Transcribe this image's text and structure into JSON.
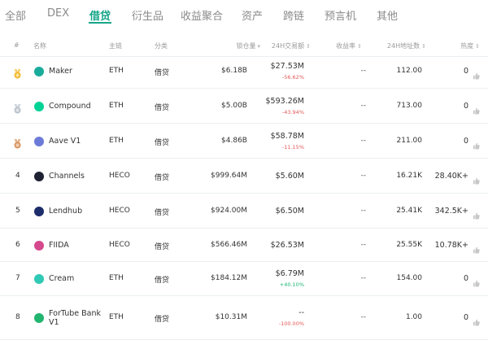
{
  "tabs": [
    {
      "label": "全部",
      "active": false
    },
    {
      "label": "DEX",
      "active": false
    },
    {
      "label": "借贷",
      "active": true
    },
    {
      "label": "衍生品",
      "active": false
    },
    {
      "label": "收益聚合",
      "active": false
    },
    {
      "label": "资产",
      "active": false
    },
    {
      "label": "跨链",
      "active": false
    },
    {
      "label": "预言机",
      "active": false
    },
    {
      "label": "其他",
      "active": false
    }
  ],
  "table": {
    "headers": {
      "rank": "#",
      "name": "名称",
      "chain": "主链",
      "category": "分类",
      "tvl": "锁仓量",
      "volume": "24H交易额",
      "yield": "收益率",
      "addresses": "24H地址数",
      "heat": "热度"
    },
    "rows": [
      {
        "rank": "",
        "medal": "gold",
        "name": "Maker",
        "name_line2": "",
        "icon_color": "#1aab9b",
        "chain": "ETH",
        "category": "借贷",
        "tvl": "$6.18B",
        "volume": "$27.53M",
        "change": "-56.62%",
        "change_dir": "neg",
        "yield": "--",
        "addresses": "112.00",
        "heat": "0"
      },
      {
        "rank": "",
        "medal": "silver",
        "name": "Compound",
        "name_line2": "",
        "icon_color": "#00d395",
        "chain": "ETH",
        "category": "借贷",
        "tvl": "$5.00B",
        "volume": "$593.26M",
        "change": "-43.94%",
        "change_dir": "neg",
        "yield": "--",
        "addresses": "713.00",
        "heat": "0"
      },
      {
        "rank": "",
        "medal": "bronze",
        "name": "Aave V1",
        "name_line2": "",
        "icon_color": "#6c7bd8",
        "chain": "ETH",
        "category": "借贷",
        "tvl": "$4.86B",
        "volume": "$58.78M",
        "change": "-11.15%",
        "change_dir": "neg",
        "yield": "--",
        "addresses": "211.00",
        "heat": "0"
      },
      {
        "rank": "4",
        "medal": "",
        "name": "Channels",
        "name_line2": "",
        "icon_color": "#1f2233",
        "chain": "HECO",
        "category": "借贷",
        "tvl": "$999.64M",
        "volume": "$5.60M",
        "change": "",
        "change_dir": "",
        "yield": "--",
        "addresses": "16.21K",
        "heat": "28.40K+"
      },
      {
        "rank": "5",
        "medal": "",
        "name": "Lendhub",
        "name_line2": "",
        "icon_color": "#1d2c6b",
        "chain": "HECO",
        "category": "借贷",
        "tvl": "$924.00M",
        "volume": "$6.50M",
        "change": "",
        "change_dir": "",
        "yield": "--",
        "addresses": "25.41K",
        "heat": "342.5K+"
      },
      {
        "rank": "6",
        "medal": "",
        "name": "FIIDA",
        "name_line2": "",
        "icon_color": "#d4488d",
        "chain": "HECO",
        "category": "借贷",
        "tvl": "$566.46M",
        "volume": "$26.53M",
        "change": "",
        "change_dir": "",
        "yield": "--",
        "addresses": "25.55K",
        "heat": "10.78K+"
      },
      {
        "rank": "7",
        "medal": "",
        "name": "Cream",
        "name_line2": "",
        "icon_color": "#30c9b5",
        "chain": "ETH",
        "category": "借贷",
        "tvl": "$184.12M",
        "volume": "$6.79M",
        "change": "+40.10%",
        "change_dir": "pos",
        "yield": "--",
        "addresses": "154.00",
        "heat": "0"
      },
      {
        "rank": "8",
        "medal": "",
        "name": "ForTube Bank",
        "name_line2": "V1",
        "icon_color": "#22b56f",
        "chain": "ETH",
        "category": "借贷",
        "tvl": "$10.31M",
        "volume": "--",
        "change": "-100.00%",
        "change_dir": "neg",
        "yield": "--",
        "addresses": "1.00",
        "heat": "0"
      }
    ]
  }
}
